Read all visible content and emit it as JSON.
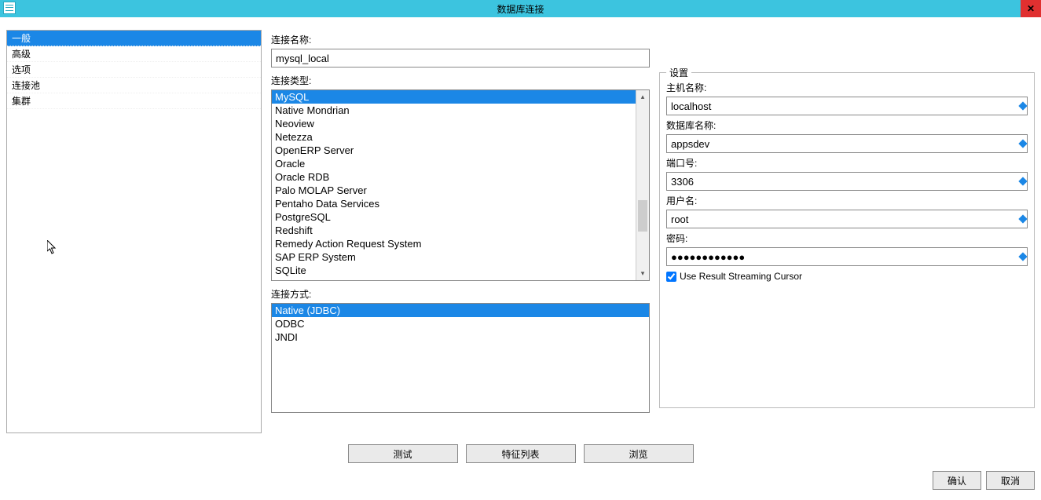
{
  "titlebar": {
    "title": "数据库连接",
    "close": "✕"
  },
  "nav": {
    "items": [
      {
        "label": "一般",
        "selected": true
      },
      {
        "label": "高级",
        "selected": false
      },
      {
        "label": "选项",
        "selected": false
      },
      {
        "label": "连接池",
        "selected": false
      },
      {
        "label": "集群",
        "selected": false
      }
    ]
  },
  "conn_name": {
    "label": "连接名称:",
    "value": "mysql_local"
  },
  "conn_type": {
    "label": "连接类型:",
    "options": [
      {
        "label": "MySQL",
        "selected": true
      },
      {
        "label": "Native Mondrian"
      },
      {
        "label": "Neoview"
      },
      {
        "label": "Netezza"
      },
      {
        "label": "OpenERP Server"
      },
      {
        "label": "Oracle"
      },
      {
        "label": "Oracle RDB"
      },
      {
        "label": "Palo MOLAP Server"
      },
      {
        "label": "Pentaho Data Services"
      },
      {
        "label": "PostgreSQL"
      },
      {
        "label": "Redshift"
      },
      {
        "label": "Remedy Action Request System"
      },
      {
        "label": "SAP ERP System"
      },
      {
        "label": "SQLite"
      }
    ]
  },
  "access": {
    "label": "连接方式:",
    "options": [
      {
        "label": "Native (JDBC)",
        "selected": true
      },
      {
        "label": "ODBC"
      },
      {
        "label": "JNDI"
      }
    ]
  },
  "settings": {
    "legend": "设置",
    "host": {
      "label": "主机名称:",
      "value": "localhost"
    },
    "db": {
      "label": "数据库名称:",
      "value": "appsdev"
    },
    "port": {
      "label": "端口号:",
      "value": "3306"
    },
    "user": {
      "label": "用户名:",
      "value": "root"
    },
    "pass": {
      "label": "密码:",
      "value": "●●●●●●●●●●●●"
    },
    "cursor_stream": {
      "label": "Use Result Streaming Cursor",
      "checked": true
    }
  },
  "buttons": {
    "test": "测试",
    "feature_list": "特征列表",
    "browse": "浏览",
    "ok": "确认",
    "cancel": "取消"
  }
}
